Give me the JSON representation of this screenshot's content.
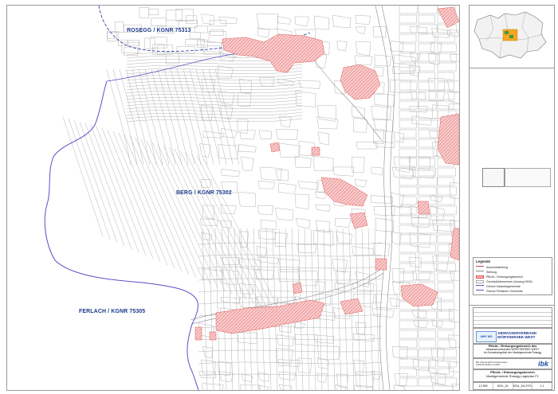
{
  "map": {
    "labels": {
      "rosegg": "ROSEGG / KGNR 75313",
      "berg": "BERG / KGNR 75302",
      "ferlach": "FERLACH / KGNR 75305"
    },
    "colors": {
      "parcel_line": "#b8b8b8",
      "cadastral_boundary": "#5a4fc8",
      "highlight_fill": "#f7c7c7",
      "highlight_hatch": "#e06a6a",
      "road": "#8a8a8a",
      "label": "#1d3b8c"
    }
  },
  "legend": {
    "title": "Legende",
    "items": [
      "Anschlussleitung",
      "Stellung",
      "Pflicht- / Entsorgungsbereich",
      "Grundstücksnummer (Auszug DKM)",
      "Grenze Katastralgemeinde",
      "Grenze Politische Gemeinde"
    ]
  },
  "titleblock": {
    "client_logo": "AWV WS",
    "client_name_1": "ABWASSERVERBAND",
    "client_name_2": "WÖRTHERSEE WEST",
    "project_1": "Pflicht- / Entsorgungsbereich des",
    "project_2": "Abwasserverbandes WÖRTHERSEE WEST",
    "project_3": "im Gemeindegebiet der Marktgemeinde Rosegg",
    "office_1": "BH Ingenieurbüro Kaiserreiter",
    "office_2": "Ziviltechnikbüro GmbH",
    "office_logo": "ibk",
    "plan_title": "Pflicht- / Entsorgungsbereich",
    "plan_sub": "Marktgemeinde Rosegg Lageplan F1",
    "footer": [
      "1:2.500",
      "K01L_16",
      "K01L_16.LP.F1",
      "1.1"
    ]
  }
}
